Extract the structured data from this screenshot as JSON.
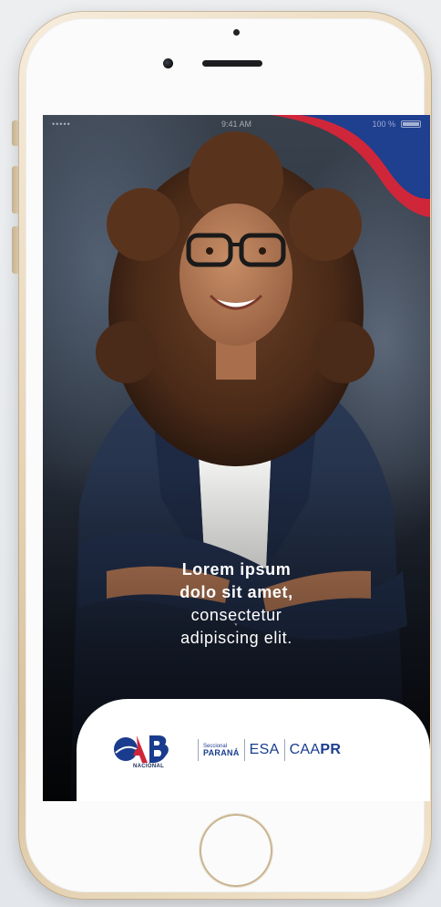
{
  "status_bar": {
    "signal": "•••••",
    "time": "9:41 AM",
    "battery": "100 %"
  },
  "hero": {
    "line1": "Lorem ipsum",
    "line2": "dolo sit amet,",
    "line3": "consectetur",
    "line4": "adipiscing elit."
  },
  "footer": {
    "logo_primary": "OAB",
    "logo_sub": "NACIONAL",
    "seccional_small": "Seccional",
    "seccional_big": "PARANÁ",
    "esa": "ESA",
    "caapr_prefix": "CAA",
    "caapr_suffix": "PR"
  },
  "colors": {
    "brand_blue": "#1a3c8f",
    "brand_red": "#d0263a",
    "accent_wave_blue": "#1f3f8f"
  },
  "icons": {
    "home_button": "home-button-icon",
    "camera": "front-camera-icon",
    "speaker": "earpiece-speaker-icon",
    "battery": "battery-icon",
    "signal": "signal-icon"
  }
}
